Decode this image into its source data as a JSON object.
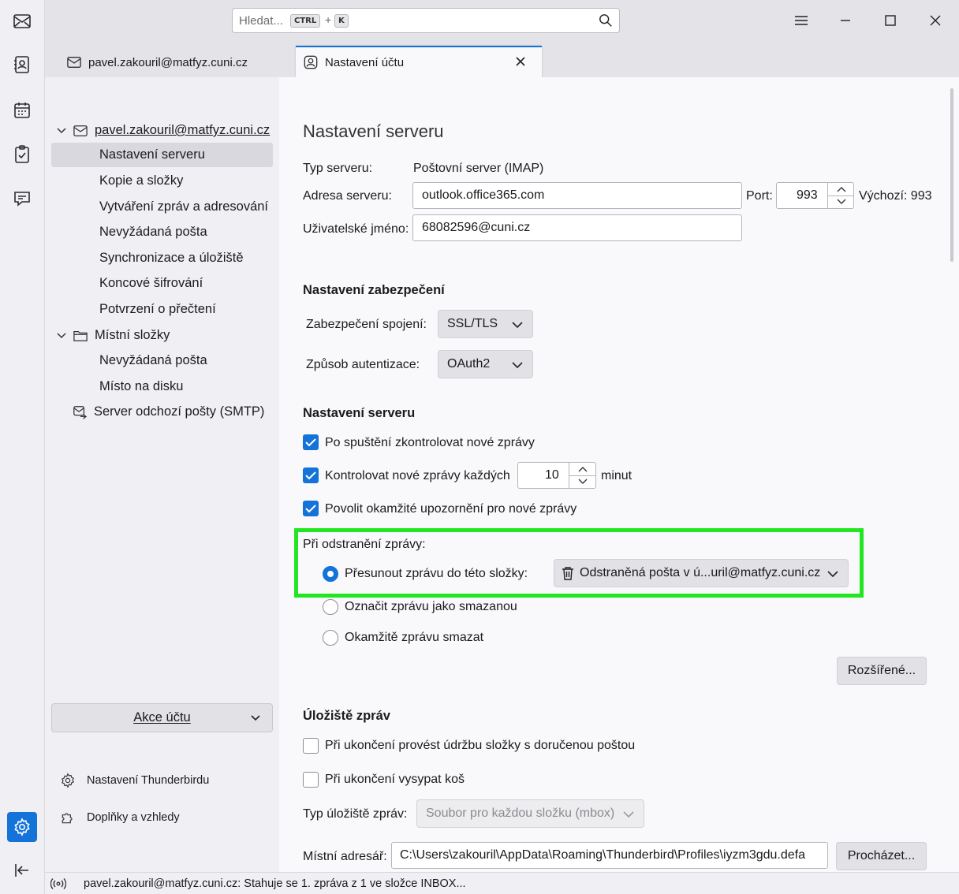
{
  "search": {
    "placeholder": "Hledat...",
    "key1": "CTRL",
    "plus": "+",
    "key2": "K"
  },
  "tabs": [
    {
      "label": "pavel.zakouril@matfyz.cuni.cz"
    },
    {
      "label": "Nastavení účtu"
    }
  ],
  "sidebar": {
    "account": "pavel.zakouril@matfyz.cuni.cz",
    "account_items": [
      "Nastavení serveru",
      "Kopie a složky",
      "Vytváření zpráv a adresování",
      "Nevyžádaná pošta",
      "Synchronizace a úložiště",
      "Koncové šifrování",
      "Potvrzení o přečtení"
    ],
    "local": "Místní složky",
    "local_items": [
      "Nevyžádaná pošta",
      "Místo na disku"
    ],
    "smtp": "Server odchozí pošty (SMTP)",
    "account_actions": "Akce účtu",
    "thunderbird_settings": "Nastavení Thunderbirdu",
    "addons": "Doplňky a vzhledy"
  },
  "content": {
    "title": "Nastavení serveru",
    "server_type_label": "Typ serveru:",
    "server_type_value": "Poštovní server (IMAP)",
    "server_address_label": "Adresa serveru:",
    "server_address_value": "outlook.office365.com",
    "port_label": "Port:",
    "port_value": "993",
    "default_port": "Výchozí: 993",
    "username_label": "Uživatelské jméno:",
    "username_value": "68082596@cuni.cz",
    "security_heading": "Nastavení zabezpečení",
    "conn_security_label": "Zabezpečení spojení:",
    "conn_security_value": "SSL/TLS",
    "auth_label": "Způsob autentizace:",
    "auth_value": "OAuth2",
    "server_heading": "Nastavení serveru",
    "check_startup": "Po spuštění zkontrolovat nové zprávy",
    "check_every": "Kontrolovat nové zprávy každých",
    "check_every_value": "10",
    "minutes": "minut",
    "idle": "Povolit okamžité upozornění pro nové zprávy",
    "delete_heading": "Při odstranění zprávy:",
    "move_to_folder": "Přesunout zprávu do této složky:",
    "trash_folder": "Odstraněná pošta v ú...uril@matfyz.cuni.cz",
    "mark_deleted": "Označit zprávu jako smazanou",
    "delete_now": "Okamžitě zprávu smazat",
    "advanced": "Rozšířené...",
    "storage_heading": "Úložiště zpráv",
    "cleanup_inbox": "Při ukončení provést údržbu složky s doručenou poštou",
    "empty_trash": "Při ukončení vysypat koš",
    "store_type_label": "Typ úložiště zpráv:",
    "store_type_value": "Soubor pro každou složku (mbox)",
    "local_dir_label": "Místní adresář:",
    "local_dir_value": "C:\\Users\\zakouril\\AppData\\Roaming\\Thunderbird\\Profiles\\iyzm3gdu.defa",
    "browse": "Procházet..."
  },
  "status": {
    "text": "pavel.zakouril@matfyz.cuni.cz: Stahuje se 1. zpráva z 1 ve složce INBOX..."
  },
  "colors": {
    "accent": "#1373d9",
    "highlight": "#22e622"
  }
}
